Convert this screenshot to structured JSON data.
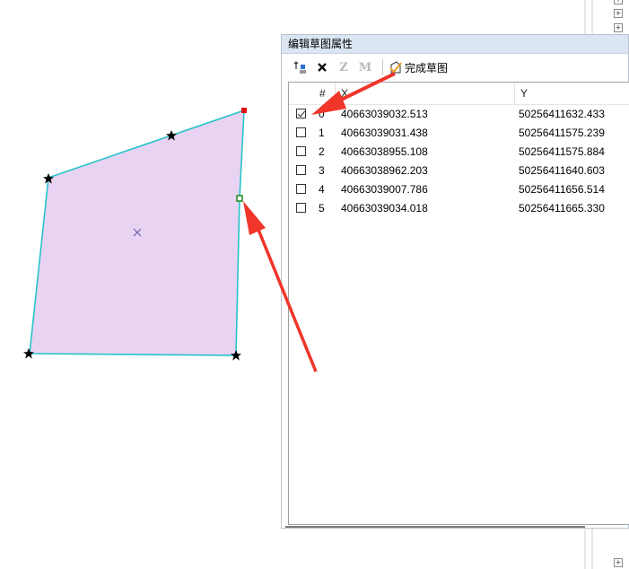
{
  "window": {
    "title": "编辑草图属性"
  },
  "toolbar": {
    "finish_sketch_label": "完成草图",
    "z_label": "Z",
    "m_label": "M"
  },
  "grid": {
    "columns": [
      "#",
      "X",
      "Y"
    ],
    "rows": [
      {
        "index": "0",
        "x": "40663039032.513",
        "y": "50256411632.433",
        "checked": true
      },
      {
        "index": "1",
        "x": "40663039031.438",
        "y": "50256411575.239",
        "checked": false
      },
      {
        "index": "2",
        "x": "40663038955.108",
        "y": "50256411575.884",
        "checked": false
      },
      {
        "index": "3",
        "x": "40663038962.203",
        "y": "50256411640.603",
        "checked": false
      },
      {
        "index": "4",
        "x": "40663039007.786",
        "y": "50256411656.514",
        "checked": false
      },
      {
        "index": "5",
        "x": "40663039034.018",
        "y": "50256411665.330",
        "checked": false
      }
    ]
  },
  "colors": {
    "polygon_fill": "#e9d3f3",
    "polygon_outline": "#27c3c9",
    "selected_vertex": "#e01010",
    "active_vertex": "#1a8a1a",
    "arrow": "#f0352a",
    "title_bar": "#dce6f3"
  },
  "icons": {
    "insert_vertex": "insert-vertex-icon",
    "delete": "delete-icon",
    "finish_sketch": "finish-sketch-icon",
    "centroid": "centroid-x-icon",
    "vertex": "star-vertex-icon"
  }
}
